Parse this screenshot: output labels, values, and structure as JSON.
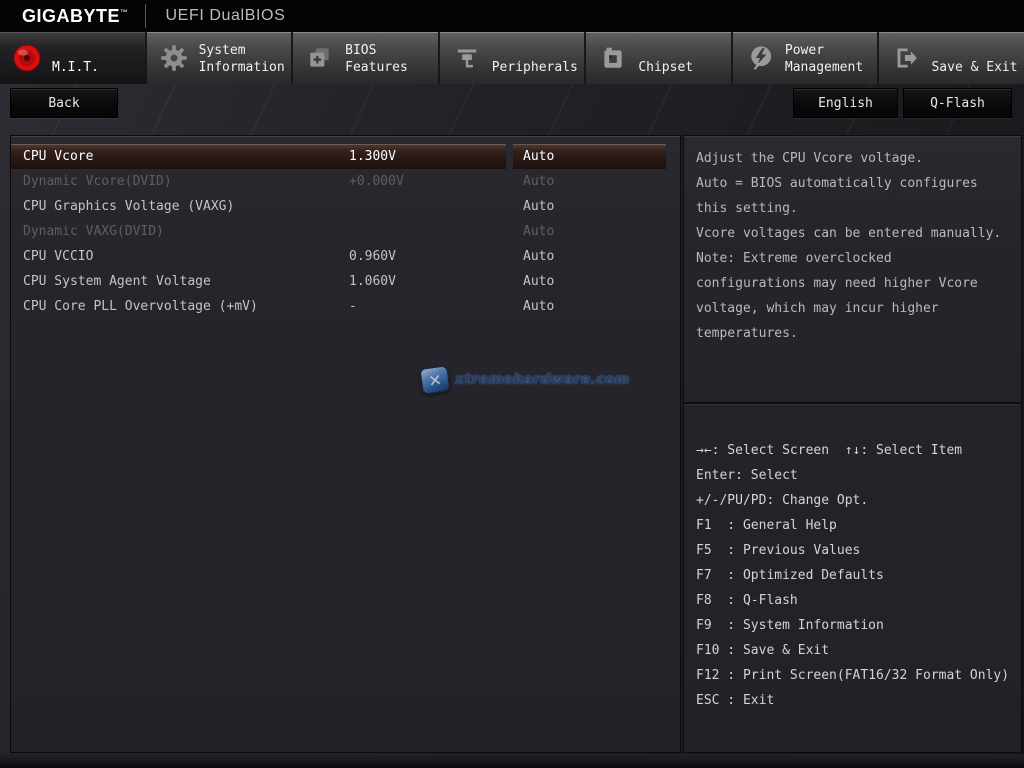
{
  "header": {
    "brand": "GIGABYTE",
    "brand_tm": "™",
    "title": "UEFI DualBIOS"
  },
  "tabs": [
    {
      "label": "M.I.T.",
      "active": true
    },
    {
      "label": "System Information",
      "active": false
    },
    {
      "label": "BIOS Features",
      "active": false
    },
    {
      "label": "Peripherals",
      "active": false
    },
    {
      "label": "Chipset",
      "active": false
    },
    {
      "label": "Power Management",
      "active": false
    },
    {
      "label": "Save & Exit",
      "active": false
    }
  ],
  "toolbar": {
    "back": "Back",
    "language": "English",
    "qflash": "Q-Flash"
  },
  "settings": {
    "rows": [
      {
        "label": "CPU Vcore",
        "value": "1.300V",
        "option": "Auto",
        "state": "selected"
      },
      {
        "label": "Dynamic Vcore(DVID)",
        "value": "+0.000V",
        "option": "Auto",
        "state": "disabled"
      },
      {
        "label": "CPU Graphics Voltage (VAXG)",
        "value": "",
        "option": "Auto",
        "state": "normal"
      },
      {
        "label": "Dynamic VAXG(DVID)",
        "value": "",
        "option": "Auto",
        "state": "disabled"
      },
      {
        "label": "CPU VCCIO",
        "value": "0.960V",
        "option": "Auto",
        "state": "normal"
      },
      {
        "label": "CPU System Agent Voltage",
        "value": "1.060V",
        "option": "Auto",
        "state": "normal"
      },
      {
        "label": "CPU Core PLL Overvoltage (+mV)",
        "value": "-",
        "option": "Auto",
        "state": "normal"
      }
    ]
  },
  "help": {
    "lines": [
      "Adjust the CPU Vcore voltage.",
      "Auto = BIOS automatically configures",
      "this setting.",
      "Vcore voltages can be entered manually.",
      "Note: Extreme overclocked",
      "configurations may need higher Vcore",
      "voltage, which may incur higher",
      "temperatures."
    ]
  },
  "keys": {
    "lines": [
      "→←: Select Screen  ↑↓: Select Item",
      "Enter: Select",
      "+/-/PU/PD: Change Opt.",
      "F1  : General Help",
      "F5  : Previous Values",
      "F7  : Optimized Defaults",
      "F8  : Q-Flash",
      "F9  : System Information",
      "F10 : Save & Exit",
      "F12 : Print Screen(FAT16/32 Format Only)",
      "ESC : Exit"
    ]
  },
  "watermark": {
    "icon_glyph": "✕",
    "text": "xtremehardware.com"
  },
  "colors": {
    "accent_red": "#d90f0f",
    "selected_row_bg": "#31201b",
    "panel_bg": "#26252b",
    "tab_inactive_top": "#636363",
    "topbar_bg": "#040404"
  }
}
